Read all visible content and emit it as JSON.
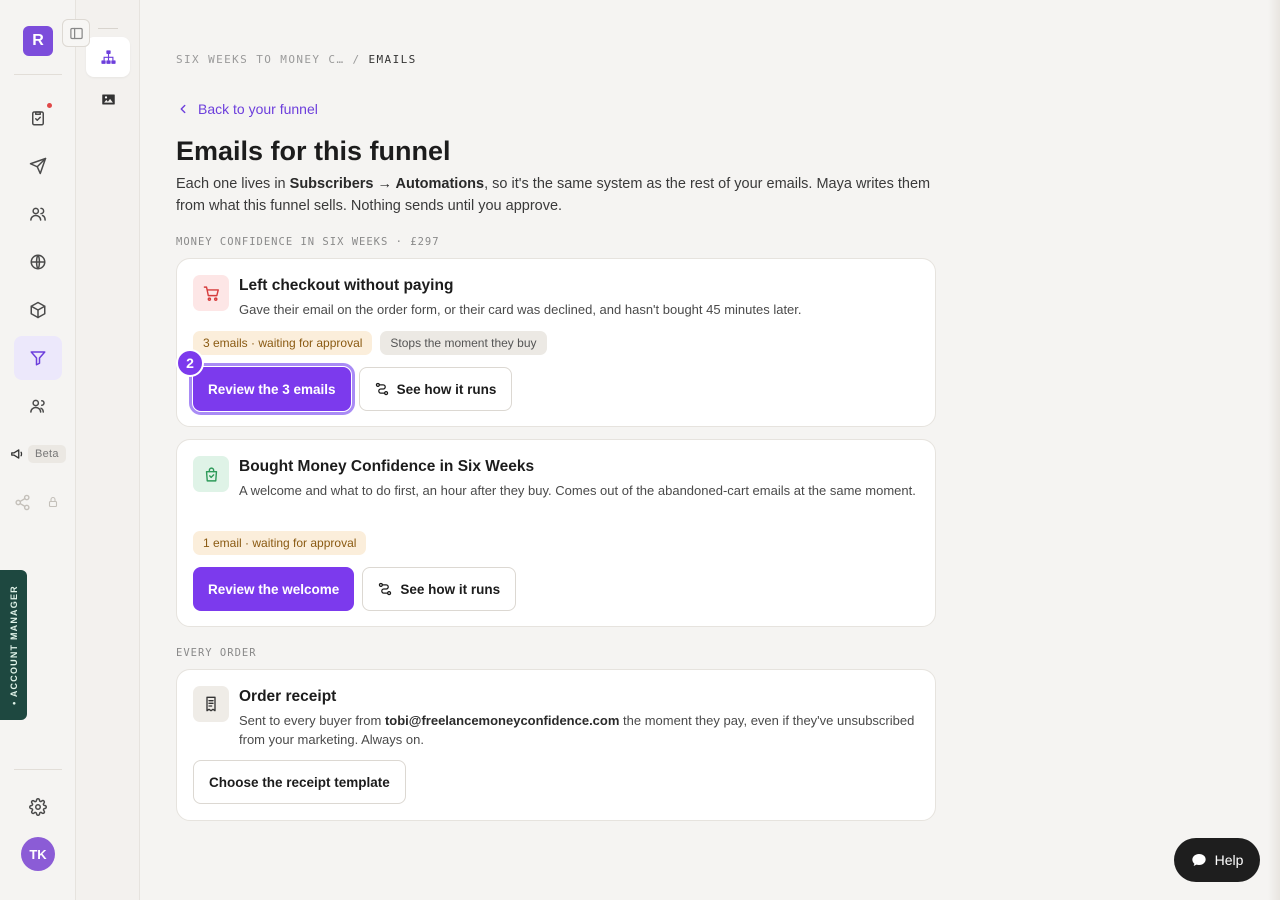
{
  "rail": {
    "brand_letter": "R",
    "beta_label": "Beta",
    "account_manager_label": "• ACCOUNT MANAGER",
    "avatar_initials": "TK",
    "items": [
      {
        "icon": "clipboard-check-icon"
      },
      {
        "icon": "send-icon"
      },
      {
        "icon": "users-icon"
      },
      {
        "icon": "globe-icon"
      },
      {
        "icon": "package-icon"
      },
      {
        "icon": "funnel-icon",
        "active": true
      },
      {
        "icon": "people-icon"
      },
      {
        "icon": "megaphone-icon"
      },
      {
        "icon": "share-icon"
      },
      {
        "icon": "lock-icon"
      },
      {
        "icon": "gear-icon"
      }
    ]
  },
  "subrail": {
    "items": [
      {
        "icon": "sitemap-icon",
        "active": true
      },
      {
        "icon": "image-icon"
      }
    ]
  },
  "breadcrumb": {
    "parent": "SIX WEEKS TO MONEY C…",
    "separator": "/",
    "current": "EMAILS"
  },
  "back_link": "Back to your funnel",
  "page_title": "Emails for this funnel",
  "intro": {
    "part1": "Each one lives in ",
    "bold1": "Subscribers → Automations",
    "part2": ", so it's the same system as the rest of your emails. Maya writes them from what this funnel sells. Nothing sends until you approve."
  },
  "sections": [
    {
      "label": "MONEY CONFIDENCE IN SIX WEEKS · £297",
      "cards": [
        {
          "icon": "cart-icon",
          "title": "Left checkout without paying",
          "desc": "Gave their email on the order form, or their card was declined, and hasn't bought 45 minutes later.",
          "pills": [
            "3 emails · waiting for approval",
            "Stops the moment they buy"
          ],
          "primary": "Review the 3 emails",
          "secondary": "See how it runs",
          "step": "2"
        },
        {
          "icon": "shopping-bag-icon",
          "title": "Bought Money Confidence in Six Weeks",
          "desc": "A welcome and what to do first, an hour after they buy. Comes out of the abandoned-cart emails at the same moment.",
          "pills": [
            "1 email · waiting for approval"
          ],
          "primary": "Review the welcome",
          "secondary": "See how it runs"
        }
      ]
    },
    {
      "label": "EVERY ORDER",
      "cards": [
        {
          "icon": "receipt-icon",
          "title": "Order receipt",
          "desc_part1": "Sent to every buyer from ",
          "desc_email": "tobi@freelancemoneyconfidence.com",
          "desc_part2": " the moment they pay, even if they've unsubscribed from your marketing. Always on.",
          "button": "Choose the receipt template"
        }
      ]
    }
  ],
  "help_label": "Help",
  "colors": {
    "accent": "#7c3aed",
    "warning_bg": "#fbeedb",
    "account_tab": "#1e4840"
  }
}
